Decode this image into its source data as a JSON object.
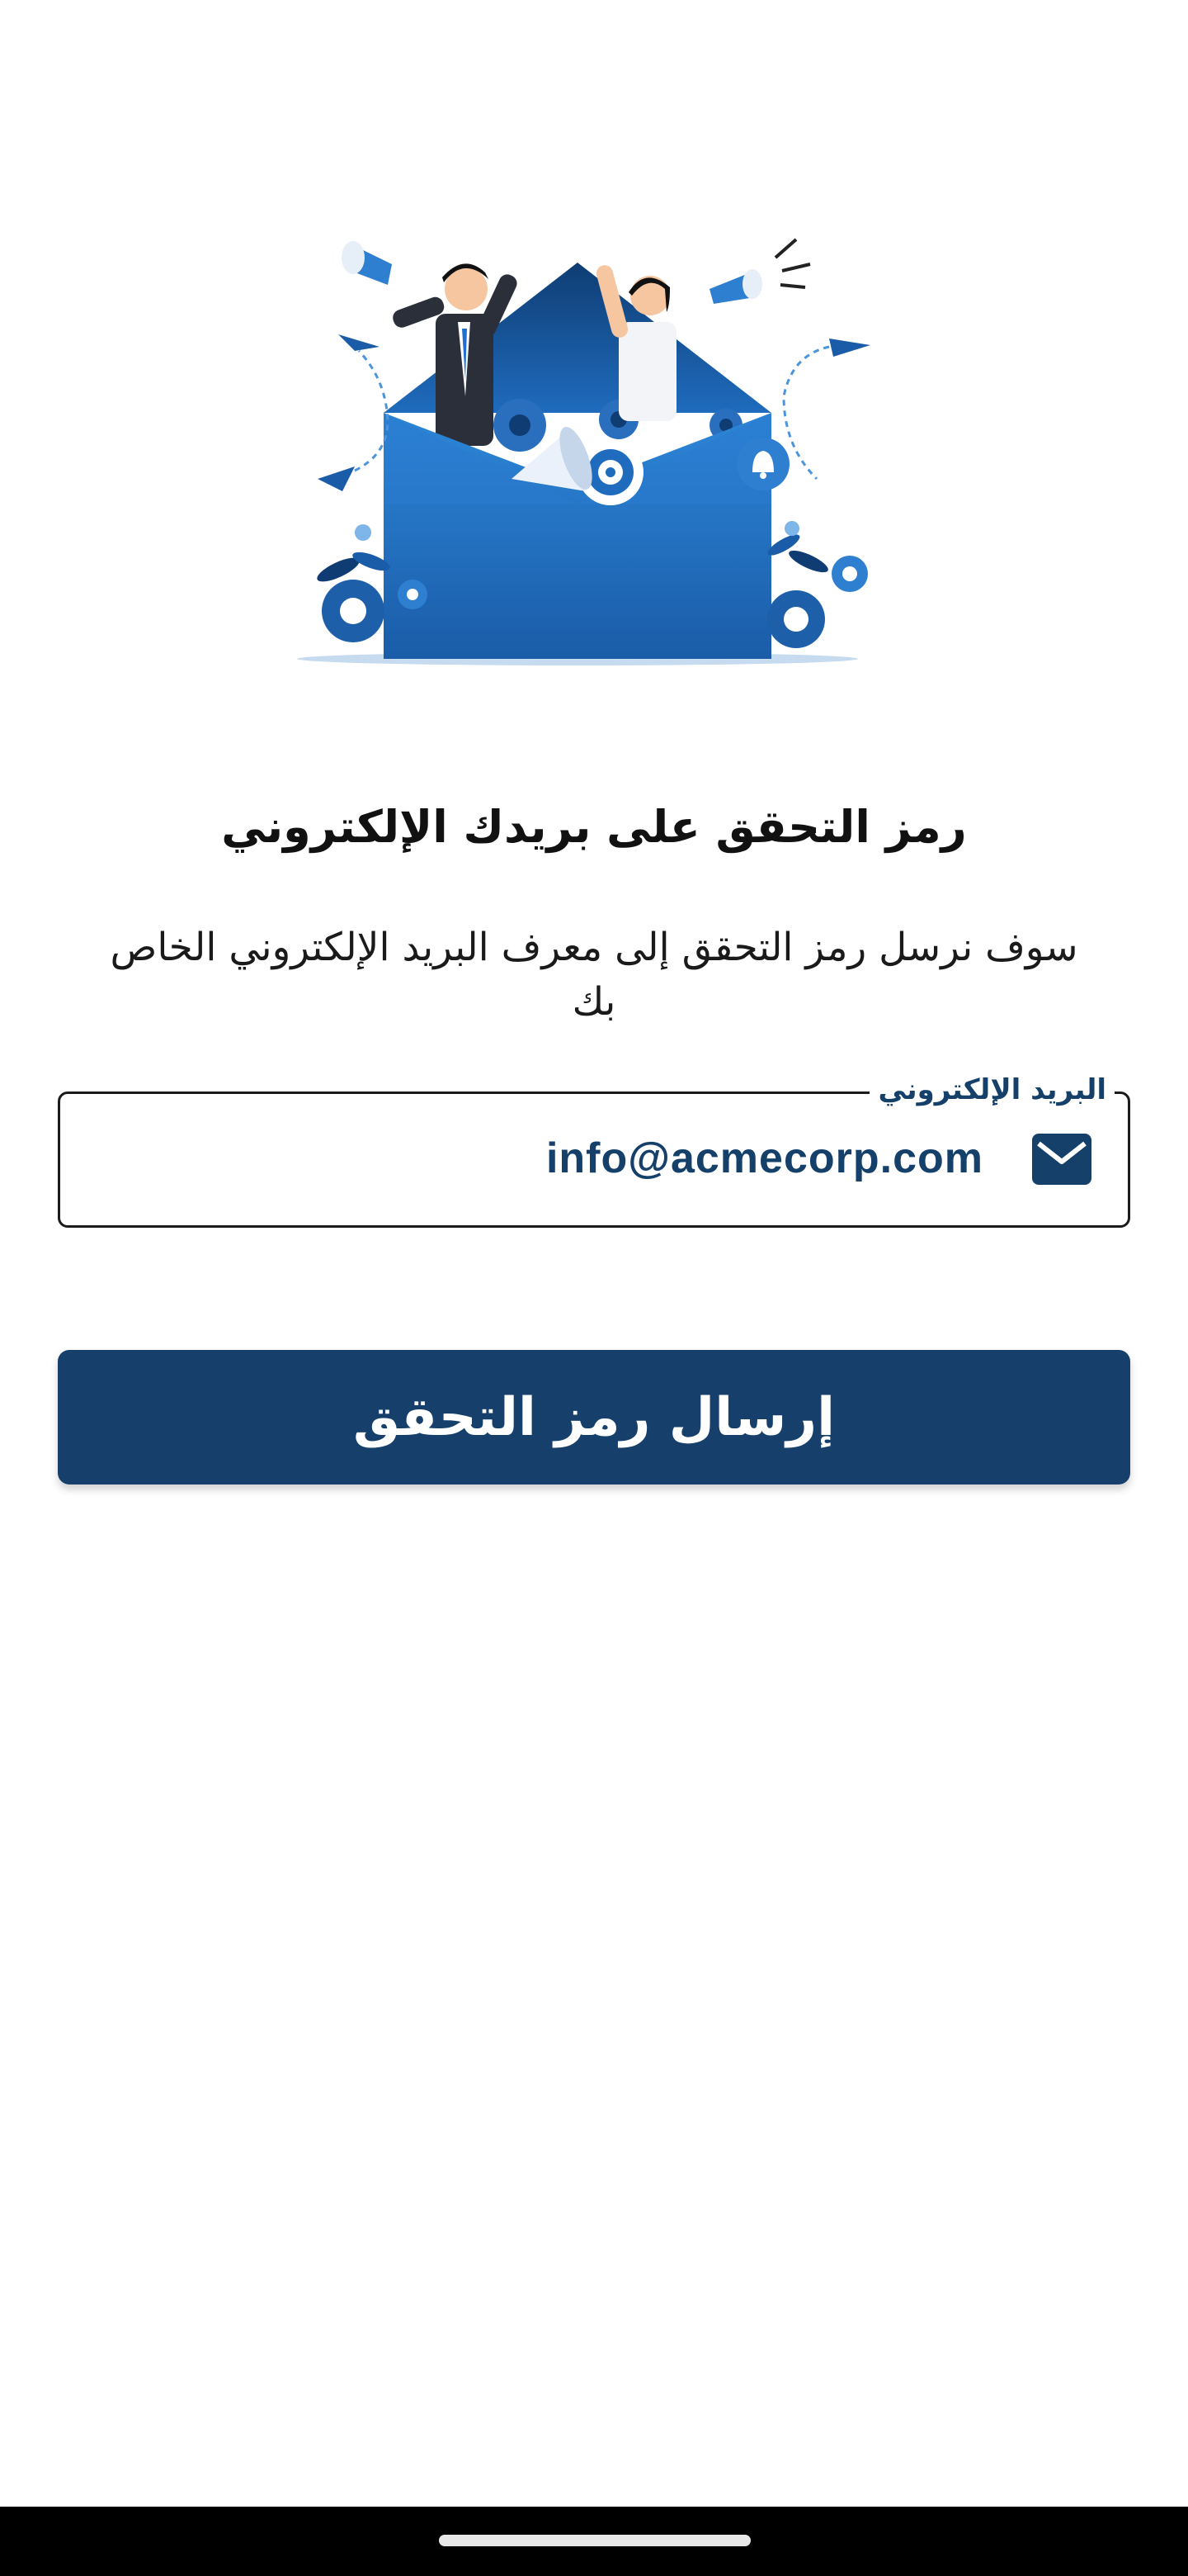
{
  "page": {
    "title": "رمز التحقق على بريدك الإلكتروني",
    "subtitle": "سوف نرسل رمز التحقق إلى معرف البريد الإلكتروني الخاص بك"
  },
  "email_field": {
    "label": "البريد الإلكتروني",
    "value": "info@acmecorp.com",
    "icon": "mail-icon"
  },
  "send_button": {
    "label": "إرسال رمز التحقق"
  },
  "hero_illustration": {
    "icon": "email-marketing-illustration"
  },
  "colors": {
    "primary": "#16406b",
    "accent": "#2f7fd1",
    "text": "#111111",
    "background": "#ffffff"
  }
}
